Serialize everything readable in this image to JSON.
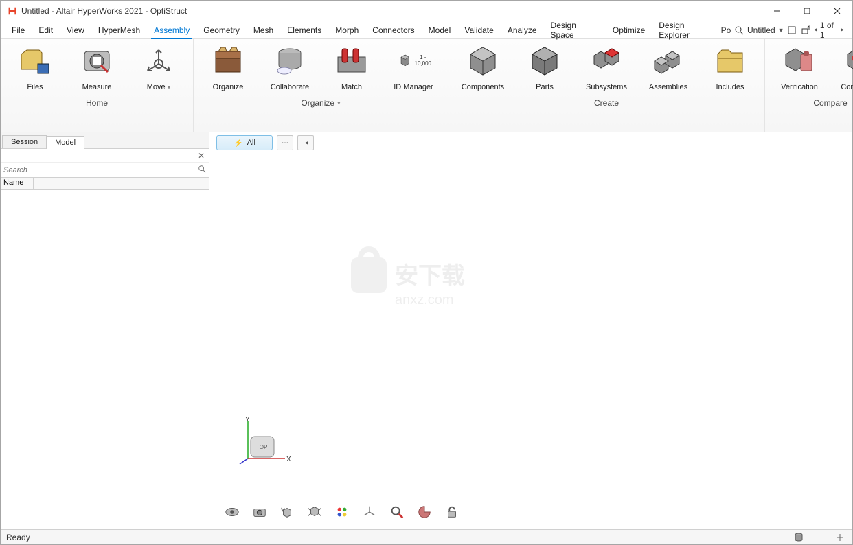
{
  "window": {
    "title": "Untitled - Altair HyperWorks 2021 - OptiStruct"
  },
  "menus": [
    "File",
    "Edit",
    "View",
    "HyperMesh",
    "Assembly",
    "Geometry",
    "Mesh",
    "Elements",
    "Morph",
    "Connectors",
    "Model",
    "Validate",
    "Analyze",
    "Design Space",
    "Optimize",
    "Design Explorer"
  ],
  "menu_active_index": 4,
  "menubar_right": {
    "po": "Po",
    "doc_name": "Untitled",
    "page_indicator": "1 of 1"
  },
  "ribbon": {
    "groups": [
      {
        "name": "Home",
        "dropdown": false,
        "items": [
          {
            "label": "Files",
            "icon": "files-icon"
          },
          {
            "label": "Measure",
            "icon": "measure-icon"
          },
          {
            "label": "Move",
            "icon": "move-icon",
            "dropdown": true
          }
        ]
      },
      {
        "name": "Organize",
        "dropdown": true,
        "items": [
          {
            "label": "Organize",
            "icon": "organize-icon"
          },
          {
            "label": "Collaborate",
            "icon": "collaborate-icon"
          },
          {
            "label": "Match",
            "icon": "match-icon"
          },
          {
            "label": "ID Manager",
            "icon": "idmanager-icon",
            "caption": "1 - 10,000"
          }
        ]
      },
      {
        "name": "Create",
        "dropdown": false,
        "items": [
          {
            "label": "Components",
            "icon": "components-icon"
          },
          {
            "label": "Parts",
            "icon": "parts-icon"
          },
          {
            "label": "Subsystems",
            "icon": "subsystems-icon"
          },
          {
            "label": "Assemblies",
            "icon": "assemblies-icon"
          },
          {
            "label": "Includes",
            "icon": "includes-icon"
          }
        ]
      },
      {
        "name": "Compare",
        "dropdown": false,
        "items": [
          {
            "label": "Verification",
            "icon": "verification-icon"
          },
          {
            "label": "Comparison",
            "icon": "comparison-icon"
          }
        ]
      }
    ]
  },
  "sidebar": {
    "tabs": [
      "Session",
      "Model"
    ],
    "active_tab_index": 1,
    "search_placeholder": "Search",
    "column_header": "Name"
  },
  "viewport": {
    "selector_label": "All",
    "axes": {
      "x": "X",
      "y": "Y",
      "top": "TOP"
    },
    "watermark_text": "安下载",
    "watermark_sub": "anxz.com"
  },
  "view_tools": [
    "eye-icon",
    "camera-icon",
    "rotate-icon",
    "fit-icon",
    "palette-icon",
    "axes-icon",
    "zoom-icon",
    "render-icon",
    "lock-icon"
  ],
  "statusbar": {
    "text": "Ready"
  },
  "colors": {
    "accent": "#0078d4"
  }
}
